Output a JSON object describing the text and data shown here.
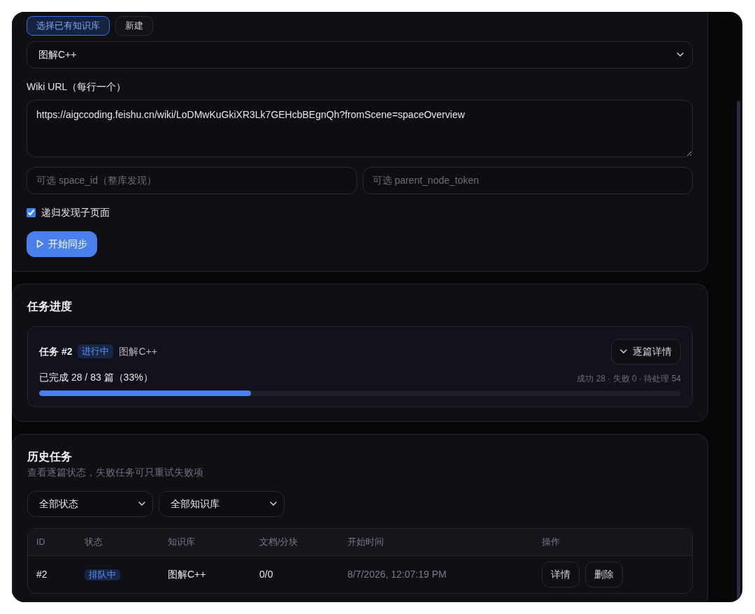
{
  "source_tabs": [
    {
      "label": "选择已有知识库",
      "selected": true
    },
    {
      "label": "新建",
      "selected": false
    }
  ],
  "knowledge_base_select": {
    "value": "图解C++"
  },
  "wiki_url": {
    "label": "Wiki URL（每行一个）",
    "value": "https://aigccoding.feishu.cn/wiki/LoDMwKuGkiXR3Lk7GEHcbBEgnQh?fromScene=spaceOverview"
  },
  "space_id": {
    "placeholder": "可选 space_id（整库发现）"
  },
  "parent_node_token": {
    "placeholder": "可选 parent_node_token"
  },
  "recursive": {
    "label": "递归发现子页面",
    "checked": true
  },
  "start_button": "开始同步",
  "progress": {
    "title": "任务进度",
    "task": "任务 #2",
    "status": "进行中",
    "knowledge_base": "图解C++",
    "detail_button": "逐篇详情",
    "completed": "已完成 28 / 83 篇（33%）",
    "stats": "成功 28 · 失败 0 · 待处理 54",
    "level": 0.33
  },
  "history": {
    "title": "历史任务",
    "subtitle": "查看逐篇状态，失败任务可只重试失败项",
    "filters": [
      {
        "value": "全部状态"
      },
      {
        "value": "全部知识库"
      }
    ],
    "columns": [
      "ID",
      "状态",
      "知识库",
      "文档/分块",
      "开始时间",
      "操作"
    ],
    "rows": [
      {
        "id": "#2",
        "status": "排队中",
        "knowledge_base": "图解C++",
        "docs": "0/0",
        "start_time": "8/7/2026, 12:07:19 PM",
        "actions": [
          "详情",
          "删除"
        ]
      }
    ]
  }
}
